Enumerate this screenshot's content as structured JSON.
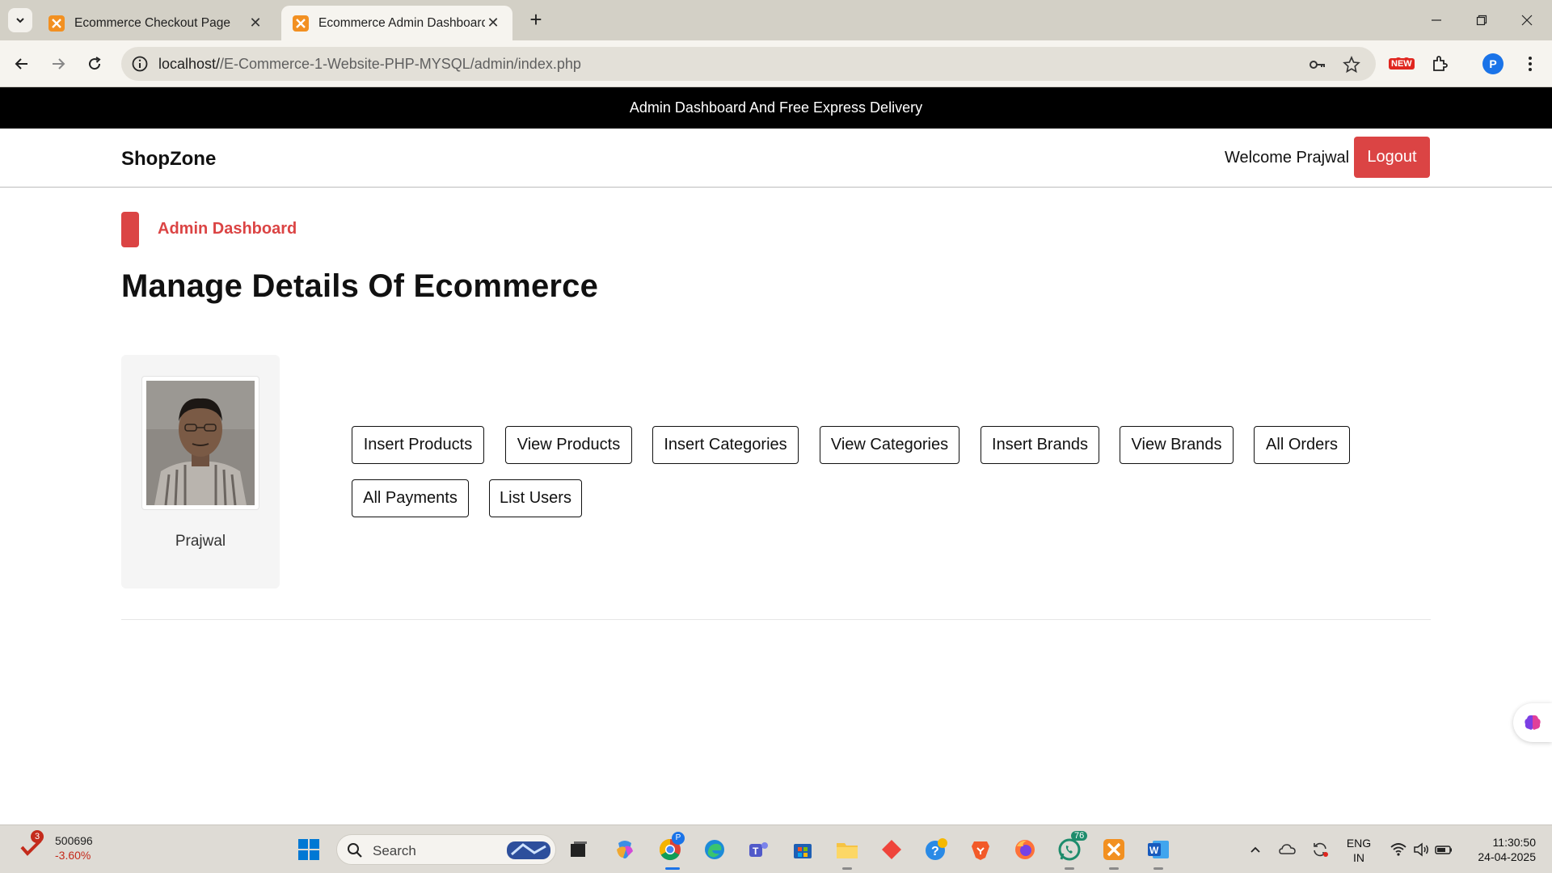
{
  "browser": {
    "tabs": [
      {
        "title": "Ecommerce Checkout Page",
        "active": false
      },
      {
        "title": "Ecommerce Admin Dashboard",
        "active": true
      }
    ],
    "url_host": "localhost/",
    "url_path": "/E-Commerce-1-Website-PHP-MYSQL/admin/index.php",
    "new_badge": "NEW",
    "profile_initial": "P"
  },
  "announcement": "Admin Dashboard And Free Express Delivery",
  "header": {
    "brand": "ShopZone",
    "welcome": "Welcome Prajwal",
    "logout_label": "Logout"
  },
  "breadcrumb": "Admin Dashboard",
  "page_title": "Manage Details Of Ecommerce",
  "profile": {
    "name": "Prajwal"
  },
  "actions": [
    "Insert Products",
    "View Products",
    "Insert Categories",
    "View Categories",
    "Insert Brands",
    "View Brands",
    "All Orders",
    "All Payments",
    "List Users"
  ],
  "colors": {
    "accent": "#db4444",
    "announcement_bg": "#000000"
  },
  "taskbar": {
    "stock_badge": "3",
    "stock_value": "500696",
    "stock_change": "-3.60%",
    "search_placeholder": "Search",
    "chrome_badge": "P",
    "whatsapp_count": "76",
    "lang": "ENG",
    "region": "IN",
    "time": "11:30:50",
    "date": "24-04-2025"
  }
}
